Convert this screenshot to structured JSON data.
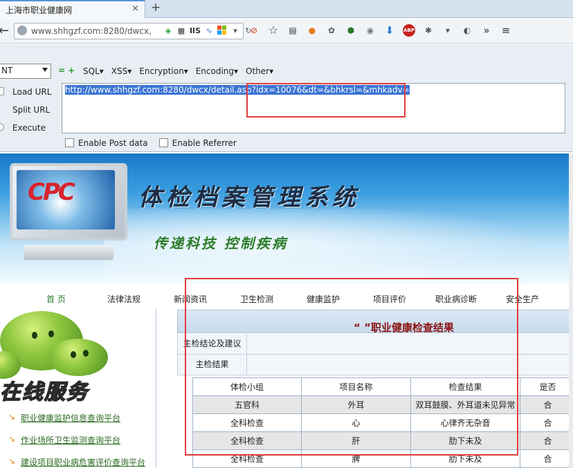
{
  "browser": {
    "tab_title": "上海市职业健康网",
    "tab_close": "×",
    "tab_new": "+",
    "url": "www.shhgzf.com:8280/dwcx,",
    "url_badge": "IIS"
  },
  "hackbar": {
    "select_value": "NT",
    "plus_minus": "= +",
    "menu": [
      "SQL▾",
      "XSS▾",
      "Encryption▾",
      "Encoding▾",
      "Other▾"
    ],
    "actions": [
      "Load URL",
      "Split URL",
      "Execute"
    ],
    "textarea_value": "http://www.shhgzf.com:8280/dwcx/detail.asp?idx=10076&dt=&bhkrsl=&mhkadv=",
    "enable_post": "Enable Post data",
    "enable_referrer": "Enable Referrer"
  },
  "banner": {
    "title": "体检档案管理系统",
    "slogan": "传递科技  控制疾病",
    "logo_text": "CPC"
  },
  "site_nav": [
    "首 页",
    "法律法规",
    "新闻资讯",
    "卫生检测",
    "健康监护",
    "项目评价",
    "职业病诊断",
    "安全生产"
  ],
  "left": {
    "service_title": "在线服务",
    "links": [
      "职业健康监护信息查询平台",
      "作业场所卫生监测查询平台",
      "建设项目职业病危害评价查询平台"
    ]
  },
  "result": {
    "title": "“ ”职业健康检查结果",
    "row1_label": "主检结论及建议",
    "row2_label": "主检结果",
    "table": {
      "headers": [
        "体检小组",
        "项目名称",
        "检查结果",
        "是否"
      ],
      "rows": [
        [
          "五官科",
          "外耳",
          "双耳鼓膜、外耳道未见异常",
          "合"
        ],
        [
          "全科检查",
          "心",
          "心律齐无杂音",
          "合"
        ],
        [
          "全科检查",
          "肝",
          "肋下未及",
          "合"
        ],
        [
          "全科检查",
          "脾",
          "肋下未及",
          "合"
        ]
      ]
    }
  },
  "colors": {
    "annotation_red": "#e33b3b",
    "selection_blue": "#3a74d4",
    "title_red": "#8b1414",
    "link_green": "#2a6a20"
  }
}
